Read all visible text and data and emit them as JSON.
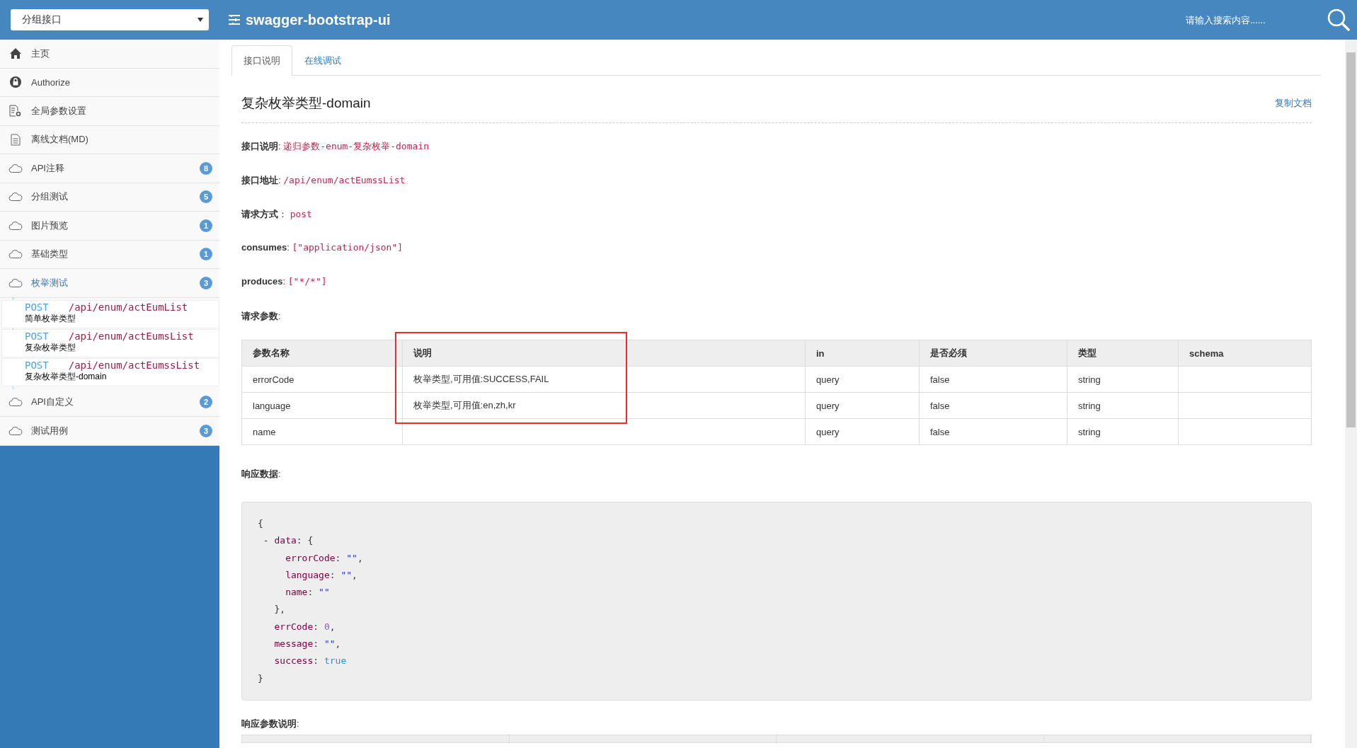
{
  "header": {
    "group_select": {
      "value": "分组接口"
    },
    "title": "swagger-bootstrap-ui",
    "search": {
      "placeholder": "请输入搜索内容......"
    }
  },
  "sidebar": {
    "items": [
      {
        "kind": "home",
        "label": "主页",
        "expanded": false
      },
      {
        "kind": "lock",
        "label": "Authorize",
        "expanded": false
      },
      {
        "kind": "settings-doc",
        "label": "全局参数设置",
        "expanded": false
      },
      {
        "kind": "doc",
        "label": "离线文档(MD)",
        "expanded": false
      },
      {
        "kind": "cloud",
        "label": "API注释",
        "count": "8",
        "expanded": false
      },
      {
        "kind": "cloud",
        "label": "分组测试",
        "count": "5",
        "expanded": false
      },
      {
        "kind": "cloud",
        "label": "图片预览",
        "count": "1",
        "expanded": false
      },
      {
        "kind": "cloud",
        "label": "基础类型",
        "count": "1",
        "expanded": false
      },
      {
        "kind": "cloud",
        "label": "枚举测试",
        "count": "3",
        "expanded": true,
        "children": [
          {
            "method": "POST",
            "path": "/api/enum/actEumList",
            "summary": "简单枚举类型"
          },
          {
            "method": "POST",
            "path": "/api/enum/actEumsList",
            "summary": "复杂枚举类型"
          },
          {
            "method": "POST",
            "path": "/api/enum/actEumssList",
            "summary": "复杂枚举类型-domain"
          }
        ]
      },
      {
        "kind": "cloud",
        "label": "API自定义",
        "count": "2",
        "expanded": false
      },
      {
        "kind": "cloud",
        "label": "测试用例",
        "count": "3",
        "expanded": false
      }
    ]
  },
  "tabs": [
    {
      "label": "接口说明",
      "selected": true
    },
    {
      "label": "在线调试",
      "selected": false
    }
  ],
  "doc": {
    "title": "复杂枚举类型-domain",
    "copy_link": "复制文档",
    "fields": [
      {
        "label": "接口说明",
        "sep": ":",
        "value": "递归参数-enum-复杂枚举-domain"
      },
      {
        "label": "接口地址",
        "sep": ":",
        "value": "/api/enum/actEumssList"
      },
      {
        "label": "请求方式",
        "sep": "：",
        "value": "post"
      },
      {
        "label": "consumes",
        "sep": ":",
        "value": "[\"application/json\"]"
      },
      {
        "label": "produces",
        "sep": ":",
        "value": "[\"*/*\"]"
      }
    ],
    "request_params_label": {
      "label": "请求参数",
      "sep": ":"
    },
    "params_table": {
      "columns": [
        "参数名称",
        "说明",
        "in",
        "是否必须",
        "类型",
        "schema"
      ],
      "rows": [
        [
          "errorCode",
          "枚举类型,可用值:SUCCESS,FAIL",
          "query",
          "false",
          "string",
          ""
        ],
        [
          "language",
          "枚举类型,可用值:en,zh,kr",
          "query",
          "false",
          "string",
          ""
        ],
        [
          "name",
          "",
          "query",
          "false",
          "string",
          ""
        ]
      ]
    },
    "response_label": {
      "label": "响应数据",
      "sep": ":"
    },
    "response_code": [
      [
        {
          "kind": "punct",
          "s": "{"
        }
      ],
      [
        {
          "kind": "punct",
          "s": " - "
        },
        {
          "kind": "key",
          "s": "data"
        },
        {
          "kind": "punct",
          "s": ": {"
        }
      ],
      [
        {
          "kind": "key",
          "s": "     errorCode"
        },
        {
          "kind": "punct",
          "s": ": "
        },
        {
          "kind": "string",
          "s": "\"\""
        },
        {
          "kind": "punct",
          "s": ","
        }
      ],
      [
        {
          "kind": "key",
          "s": "     language"
        },
        {
          "kind": "punct",
          "s": ": "
        },
        {
          "kind": "string",
          "s": "\"\""
        },
        {
          "kind": "punct",
          "s": ","
        }
      ],
      [
        {
          "kind": "key",
          "s": "     name"
        },
        {
          "kind": "punct",
          "s": ": "
        },
        {
          "kind": "string",
          "s": "\"\""
        }
      ],
      [
        {
          "kind": "punct",
          "s": "   },"
        }
      ],
      [
        {
          "kind": "key",
          "s": "   errCode"
        },
        {
          "kind": "punct",
          "s": ": "
        },
        {
          "kind": "number",
          "s": "0"
        },
        {
          "kind": "punct",
          "s": ","
        }
      ],
      [
        {
          "kind": "key",
          "s": "   message"
        },
        {
          "kind": "punct",
          "s": ": "
        },
        {
          "kind": "string",
          "s": "\"\""
        },
        {
          "kind": "punct",
          "s": ","
        }
      ],
      [
        {
          "kind": "key",
          "s": "   success"
        },
        {
          "kind": "punct",
          "s": ": "
        },
        {
          "kind": "bool",
          "s": "true"
        }
      ],
      [
        {
          "kind": "punct",
          "s": "}"
        }
      ]
    ],
    "response_params_label": {
      "label": "响应参数说明",
      "sep": ":"
    }
  }
}
